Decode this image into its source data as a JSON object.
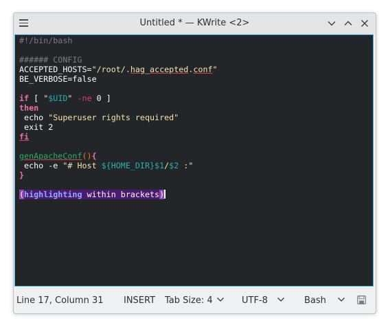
{
  "window": {
    "title": "Untitled * — KWrite <2>"
  },
  "code_lines": [
    [
      {
        "t": "#!/bin/bash",
        "c": "c-comment"
      }
    ],
    [],
    [
      {
        "t": "###### CONFIG",
        "c": "c-comment"
      }
    ],
    [
      {
        "t": "ACCEPTED_HOSTS",
        "c": "c-var-light"
      },
      {
        "t": "=",
        "c": ""
      },
      {
        "t": "\"/root/.",
        "c": "c-str"
      },
      {
        "t": "hag",
        "c": "c-str err"
      },
      {
        "t": "_",
        "c": "c-str"
      },
      {
        "t": "accepted",
        "c": "c-str err"
      },
      {
        "t": ".",
        "c": "c-str"
      },
      {
        "t": "conf",
        "c": "c-str err"
      },
      {
        "t": "\"",
        "c": "c-str"
      }
    ],
    [
      {
        "t": "BE_VERBOSE",
        "c": ""
      },
      {
        "t": "=",
        "c": ""
      },
      {
        "t": "false",
        "c": ""
      }
    ],
    [],
    [
      {
        "t": "if",
        "c": "c-kw"
      },
      {
        "t": " [ ",
        "c": ""
      },
      {
        "t": "\"",
        "c": "c-str"
      },
      {
        "t": "$UID",
        "c": "c-var"
      },
      {
        "t": "\"",
        "c": "c-str"
      },
      {
        "t": " ",
        "c": ""
      },
      {
        "t": "-ne",
        "c": "c-opt"
      },
      {
        "t": " 0 ]",
        "c": ""
      }
    ],
    [
      {
        "t": "then",
        "c": "c-kw"
      }
    ],
    [
      {
        "t": " echo ",
        "c": ""
      },
      {
        "t": "\"Superuser rights required\"",
        "c": "c-str"
      }
    ],
    [
      {
        "t": " exit 2",
        "c": ""
      }
    ],
    [
      {
        "t": "fi",
        "c": "c-kw err"
      }
    ],
    [],
    [
      {
        "t": "genApacheConf",
        "c": "c-fname err"
      },
      {
        "t": "()",
        "c": "c-paren"
      },
      {
        "t": "{",
        "c": "c-brace"
      }
    ],
    [
      {
        "t": " echo -e ",
        "c": ""
      },
      {
        "t": "\"# Host ",
        "c": "c-str"
      },
      {
        "t": "${HOME_DIR}",
        "c": "c-var"
      },
      {
        "t": "$1",
        "c": "c-var"
      },
      {
        "t": "/",
        "c": "c-str"
      },
      {
        "t": "$2",
        "c": "c-var"
      },
      {
        "t": " :\"",
        "c": "c-str"
      }
    ],
    [
      {
        "t": "}",
        "c": "c-brace"
      }
    ],
    [],
    [
      {
        "t": "(",
        "c": "hl-bracket"
      },
      {
        "t": "highlighting",
        "c": "hl-inner hl-blue"
      },
      {
        "t": " within brackets",
        "c": "hl-inner"
      },
      {
        "t": ")",
        "c": "hl-bracket"
      },
      {
        "t": "",
        "c": "cursor"
      }
    ]
  ],
  "statusbar": {
    "position": "Line 17, Column 31",
    "mode": "INSERT",
    "tab_size": "Tab Size: 4",
    "encoding": "UTF-8",
    "syntax": "Bash"
  },
  "icons": {
    "menu": "hamburger-menu-icon",
    "minimize": "chevron-down-icon",
    "maximize": "chevron-up-icon",
    "close": "close-icon",
    "save": "save-icon"
  },
  "colors": {
    "editor_bg": "#232629",
    "focus_border": "#3daee9",
    "keyword": "#ee6ea6",
    "string": "#f4e3a6",
    "variable": "#27aeae",
    "comment": "#7a7c7d",
    "bracket_highlight": "#8e44ad"
  }
}
